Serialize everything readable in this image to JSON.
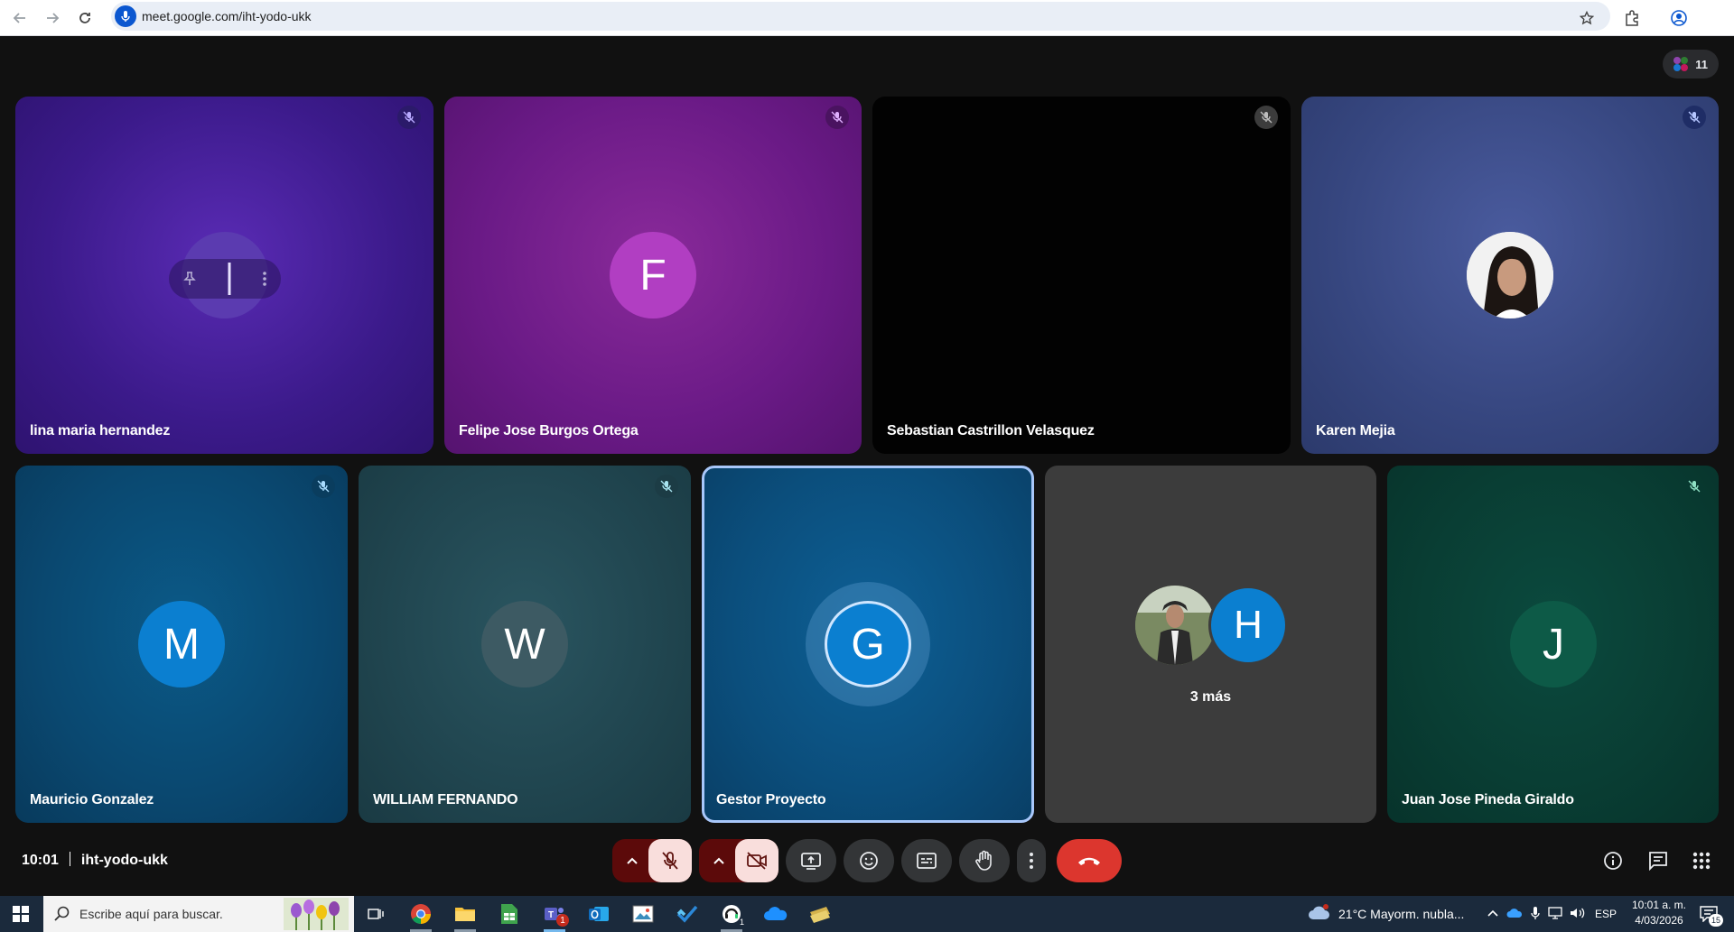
{
  "browser": {
    "url": "meet.google.com/iht-yodo-ukk"
  },
  "meet": {
    "participant_count": "11",
    "tiles": [
      {
        "name": "lina maria hernandez"
      },
      {
        "name": "Felipe Jose Burgos Ortega",
        "initial": "F"
      },
      {
        "name": "Sebastian Castrillon Velasquez"
      },
      {
        "name": "Karen Mejia"
      },
      {
        "name": "Mauricio Gonzalez",
        "initial": "M"
      },
      {
        "name": "WILLIAM FERNANDO",
        "initial": "W"
      },
      {
        "name": "Gestor Proyecto",
        "initial": "G"
      },
      {
        "name": "3 más",
        "initial": "H"
      },
      {
        "name": "Juan Jose Pineda Giraldo",
        "initial": "J"
      }
    ],
    "time": "10:01",
    "meeting_code": "iht-yodo-ukk"
  },
  "colors": {
    "accent_blue": "#0b57d0",
    "hangup_red": "#dc362e",
    "active_speaker_border": "#a8c7fa"
  },
  "taskbar": {
    "search_placeholder": "Escribe aquí para buscar.",
    "weather": "21°C  Mayorm. nubla...",
    "language": "ESP",
    "time": "10:01 a. m.",
    "date": "4/03/2026",
    "teams_badge": "1",
    "notif_count": "15"
  }
}
